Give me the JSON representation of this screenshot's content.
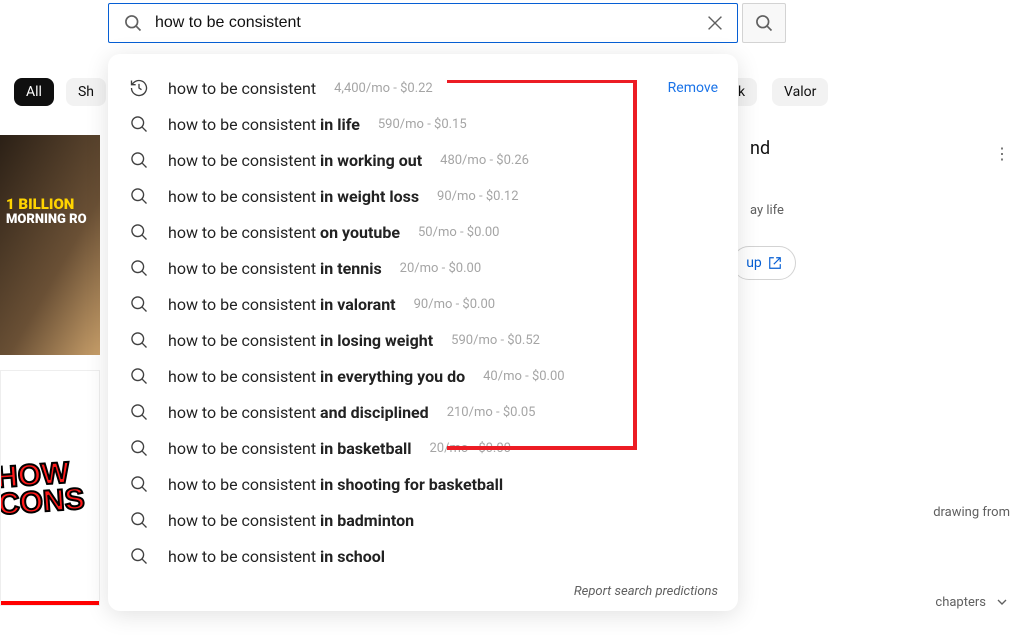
{
  "search": {
    "value": "how to be consistent",
    "placeholder": "Search"
  },
  "chips": [
    {
      "label": "All",
      "active": true
    },
    {
      "label": "Sh"
    },
    {
      "label": "k"
    },
    {
      "label": "Valor"
    }
  ],
  "suggestions": [
    {
      "history": true,
      "base": "how to be consistent",
      "ext": "",
      "stats": "4,400/mo - $0.22",
      "removable": true
    },
    {
      "history": false,
      "base": "how to be consistent ",
      "ext": "in life",
      "stats": "590/mo - $0.15"
    },
    {
      "history": false,
      "base": "how to be consistent ",
      "ext": "in working out",
      "stats": "480/mo - $0.26"
    },
    {
      "history": false,
      "base": "how to be consistent ",
      "ext": "in weight loss",
      "stats": "90/mo - $0.12"
    },
    {
      "history": false,
      "base": "how to be consistent ",
      "ext": "on youtube",
      "stats": "50/mo - $0.00"
    },
    {
      "history": false,
      "base": "how to be consistent ",
      "ext": "in tennis",
      "stats": "20/mo - $0.00"
    },
    {
      "history": false,
      "base": "how to be consistent ",
      "ext": "in valorant",
      "stats": "90/mo - $0.00"
    },
    {
      "history": false,
      "base": "how to be consistent ",
      "ext": "in losing weight",
      "stats": "590/mo - $0.52"
    },
    {
      "history": false,
      "base": "how to be consistent ",
      "ext": "in everything you do",
      "stats": "40/mo - $0.00"
    },
    {
      "history": false,
      "base": "how to be consistent ",
      "ext": "and disciplined",
      "stats": "210/mo - $0.05"
    },
    {
      "history": false,
      "base": "how to be consistent ",
      "ext": "in basketball",
      "stats": "20/mo - $0.00"
    },
    {
      "history": false,
      "base": "how to be consistent ",
      "ext": "in shooting for basketball",
      "stats": ""
    },
    {
      "history": false,
      "base": "how to be consistent ",
      "ext": "in badminton",
      "stats": ""
    },
    {
      "history": false,
      "base": "how to be consistent ",
      "ext": "in school",
      "stats": ""
    }
  ],
  "remove_label": "Remove",
  "report_label": "Report search predictions",
  "bg": {
    "thumb1_line1": "1 BILLION",
    "thumb1_line2": "MORNING RO",
    "thumb2_text": "HOW\nCONS",
    "right_title": "nd",
    "right_desc": "ay life",
    "signup": "up",
    "drawing": "drawing from",
    "chapters": "chapters"
  }
}
